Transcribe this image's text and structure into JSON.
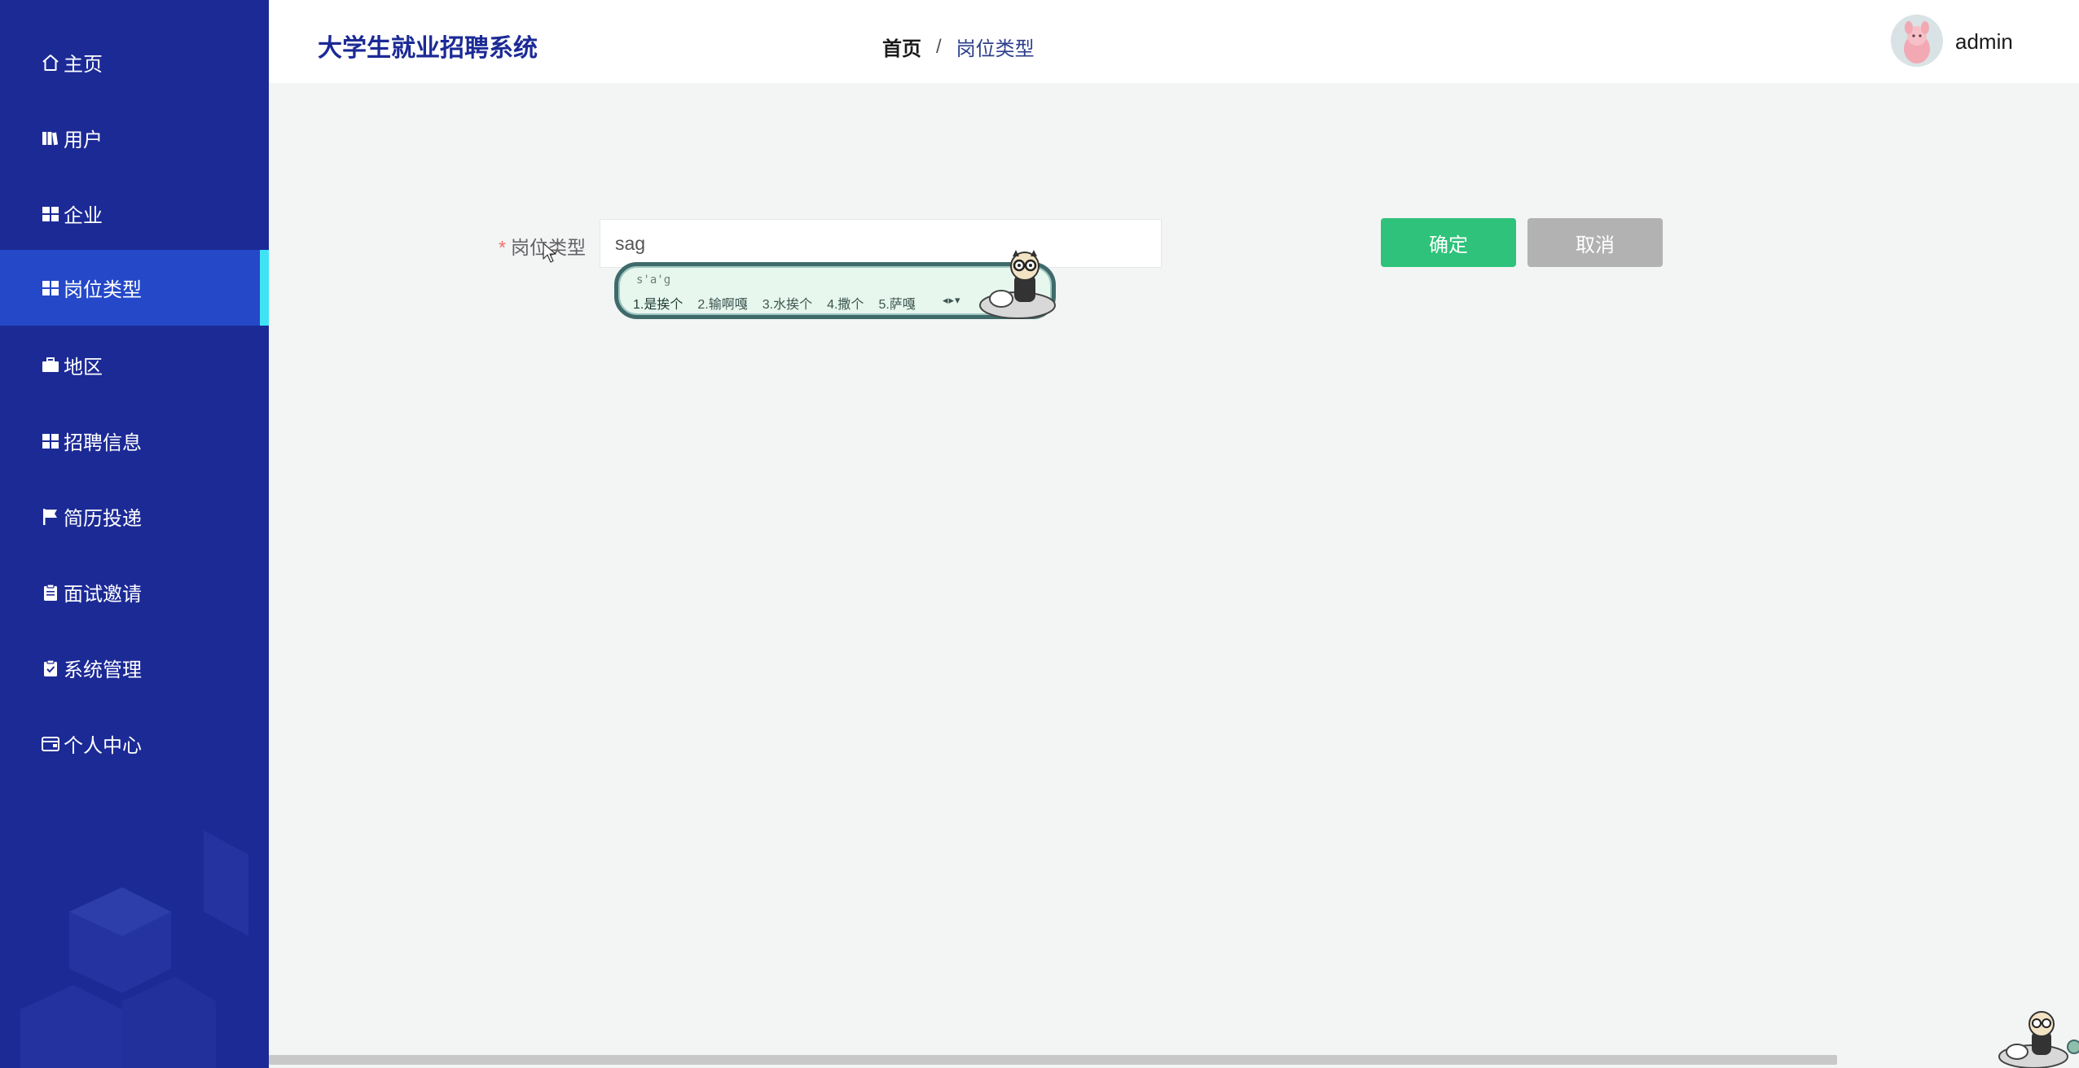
{
  "app": {
    "title": "大学生就业招聘系统"
  },
  "sidebar": {
    "items": [
      {
        "label": "主页",
        "icon": "home-icon"
      },
      {
        "label": "用户",
        "icon": "book-icon"
      },
      {
        "label": "企业",
        "icon": "grid-icon"
      },
      {
        "label": "岗位类型",
        "icon": "grid-icon",
        "active": true
      },
      {
        "label": "地区",
        "icon": "briefcase-icon"
      },
      {
        "label": "招聘信息",
        "icon": "grid-icon"
      },
      {
        "label": "简历投递",
        "icon": "flag-icon"
      },
      {
        "label": "面试邀请",
        "icon": "clipboard-icon"
      },
      {
        "label": "系统管理",
        "icon": "clipboard-check-icon"
      },
      {
        "label": "个人中心",
        "icon": "wallet-icon"
      }
    ]
  },
  "breadcrumb": {
    "home": "首页",
    "separator": "/",
    "current": "岗位类型"
  },
  "user": {
    "name": "admin"
  },
  "form": {
    "required_mark": "*",
    "label": "岗位类型",
    "value": "sag",
    "confirm": "确定",
    "cancel": "取消"
  },
  "ime": {
    "pinyin": "s'a'g",
    "candidates": [
      "1.是挨个",
      "2.输啊嘎",
      "3.水挨个",
      "4.撒个",
      "5.萨嘎"
    ]
  },
  "colors": {
    "sidebar_bg": "#1c2a96",
    "sidebar_active": "#2448c8",
    "active_indicator": "#3fe3f5",
    "confirm_button": "#2ec27a",
    "cancel_button": "#b2b2b2"
  }
}
